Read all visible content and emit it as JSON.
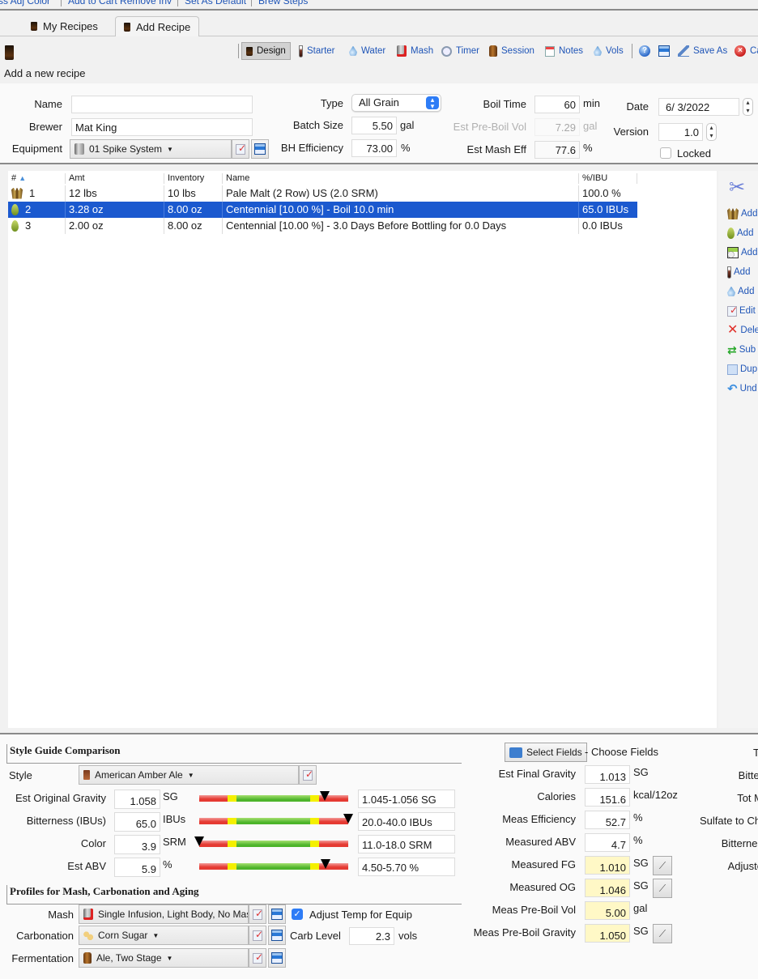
{
  "menu_strip": {
    "items": [
      "ss  Adj Color",
      "Add to Cart  Remove Inv",
      "Set As Default",
      "Brew Steps"
    ]
  },
  "tabs": [
    {
      "label": "My Recipes",
      "icon": "pint-glass-icon",
      "active": false
    },
    {
      "label": "Add Recipe",
      "icon": "pint-glass-icon",
      "active": true
    }
  ],
  "toolbar": {
    "items": [
      {
        "label": "Design",
        "icon": "pint-glass-icon",
        "pressed": true
      },
      {
        "label": "Starter",
        "icon": "test-tube-icon"
      },
      {
        "label": "Water",
        "icon": "water-drop-icon"
      },
      {
        "label": "Mash",
        "icon": "mash-tun-icon"
      },
      {
        "label": "Timer",
        "icon": "clock-icon"
      },
      {
        "label": "Session",
        "icon": "fermenter-icon"
      },
      {
        "label": "Notes",
        "icon": "notes-icon"
      },
      {
        "label": "Vols",
        "icon": "water-drop-icon"
      },
      {
        "label": "",
        "icon": "help-icon"
      },
      {
        "label": "",
        "icon": "save-disk-icon"
      },
      {
        "label": "Save As",
        "icon": "pen-icon"
      },
      {
        "label": "Ca",
        "icon": "cancel-icon"
      }
    ]
  },
  "subtitle": "Add a new recipe",
  "form": {
    "name": {
      "label": "Name",
      "value": ""
    },
    "brewer": {
      "label": "Brewer",
      "value": "Mat King"
    },
    "equipment": {
      "label": "Equipment",
      "value": "01 Spike System"
    },
    "type": {
      "label": "Type",
      "value": "All Grain"
    },
    "batch_size": {
      "label": "Batch Size",
      "value": "5.50",
      "unit": "gal"
    },
    "bh_efficiency": {
      "label": "BH Efficiency",
      "value": "73.00",
      "unit": "%"
    },
    "boil_time": {
      "label": "Boil Time",
      "value": "60",
      "unit": "min"
    },
    "est_pre_boil_vol": {
      "label": "Est Pre-Boil Vol",
      "value": "7.29",
      "unit": "gal"
    },
    "est_mash_eff": {
      "label": "Est Mash Eff",
      "value": "77.6",
      "unit": "%"
    },
    "date": {
      "label": "Date",
      "value": "6/  3/2022"
    },
    "version": {
      "label": "Version",
      "value": "1.0"
    },
    "locked": {
      "label": "Locked",
      "checked": false
    }
  },
  "ingredients": {
    "columns": [
      "#",
      "Amt",
      "Inventory",
      "Name",
      "%/IBU"
    ],
    "rows": [
      {
        "num": "1",
        "icon": "grain-icon",
        "amt": "12 lbs",
        "inventory": "10 lbs",
        "name": "Pale Malt (2 Row) US (2.0 SRM)",
        "pct_ibu": "100.0 %",
        "selected": false
      },
      {
        "num": "2",
        "icon": "hop-icon",
        "amt": "3.28 oz",
        "inventory": "8.00 oz",
        "name": "Centennial [10.00 %] - Boil 10.0 min",
        "pct_ibu": "65.0 IBUs",
        "selected": true
      },
      {
        "num": "3",
        "icon": "hop-icon",
        "amt": "2.00 oz",
        "inventory": "8.00 oz",
        "name": "Centennial [10.00 %] - 3.0 Days Before Bottling for 0.0 Days",
        "pct_ibu": "0.0 IBUs",
        "selected": false
      }
    ]
  },
  "side_panel": {
    "items": [
      {
        "label": "Add",
        "icon": "grain-icon"
      },
      {
        "label": "Add",
        "icon": "hop-icon"
      },
      {
        "label": "Add",
        "icon": "yeast-icon"
      },
      {
        "label": "Add",
        "icon": "test-tube-icon"
      },
      {
        "label": "Add",
        "icon": "water-drop-icon"
      },
      {
        "label": "Edit",
        "icon": "edit-check-icon"
      },
      {
        "label": "Dele",
        "icon": "delete-x-icon"
      },
      {
        "label": "Sub",
        "icon": "substitute-arrows-icon"
      },
      {
        "label": "Dup",
        "icon": "duplicate-icon"
      },
      {
        "label": "Und",
        "icon": "undo-icon"
      }
    ]
  },
  "style_guide": {
    "title": "Style Guide Comparison",
    "style_label": "Style",
    "style_value": "American Amber Ale",
    "rows": [
      {
        "label": "Est Original Gravity",
        "value": "1.058",
        "unit": "SG",
        "range": "1.045-1.056 SG",
        "marker": 0.84
      },
      {
        "label": "Bitterness (IBUs)",
        "value": "65.0",
        "unit": "IBUs",
        "range": "20.0-40.0 IBUs",
        "marker": 1.0
      },
      {
        "label": "Color",
        "value": "3.9",
        "unit": "SRM",
        "range": "11.0-18.0 SRM",
        "marker": 0.0
      },
      {
        "label": "Est ABV",
        "value": "5.9",
        "unit": "%",
        "range": "4.50-5.70 %",
        "marker": 0.85
      }
    ],
    "gauge_colors": {
      "red": "#e53a32",
      "yellow": "#f4f000",
      "green": "#4cb42a"
    }
  },
  "profiles": {
    "title": "Profiles for Mash, Carbonation and Aging",
    "mash": {
      "label": "Mash",
      "value": "Single Infusion, Light Body, No Mas"
    },
    "adjust_temp": {
      "label": "Adjust Temp for Equip",
      "checked": true
    },
    "carbonation": {
      "label": "Carbonation",
      "value": "Corn Sugar"
    },
    "carb_level": {
      "label": "Carb Level",
      "value": "2.3",
      "unit": "vols"
    },
    "fermentation": {
      "label": "Fermentation",
      "value": "Ale, Two Stage"
    }
  },
  "stats": {
    "select_fields_label": "Select Fields",
    "choose_fields_text": "- Choose Fields",
    "rows": [
      {
        "label": "Est Final Gravity",
        "value": "1.013",
        "unit": "SG",
        "measured": false,
        "hydrometer": false
      },
      {
        "label": "Calories",
        "value": "151.6",
        "unit": "kcal/12oz",
        "measured": false,
        "hydrometer": false
      },
      {
        "label": "Meas Efficiency",
        "value": "52.7",
        "unit": "%",
        "measured": false,
        "hydrometer": false
      },
      {
        "label": "Measured ABV",
        "value": "4.7",
        "unit": "%",
        "measured": false,
        "hydrometer": false
      },
      {
        "label": "Measured FG",
        "value": "1.010",
        "unit": "SG",
        "measured": true,
        "hydrometer": true
      },
      {
        "label": "Measured OG",
        "value": "1.046",
        "unit": "SG",
        "measured": true,
        "hydrometer": true
      },
      {
        "label": "Meas Pre-Boil Vol",
        "value": "5.00",
        "unit": "gal",
        "measured": true,
        "hydrometer": false
      },
      {
        "label": "Meas Pre-Boil Gravity",
        "value": "1.050",
        "unit": "SG",
        "measured": true,
        "hydrometer": true
      }
    ],
    "right_column_labels": [
      "T",
      "Bitter",
      "Tot M",
      "Sulfate to Chl",
      "Bitternes",
      "Adjuste"
    ]
  }
}
